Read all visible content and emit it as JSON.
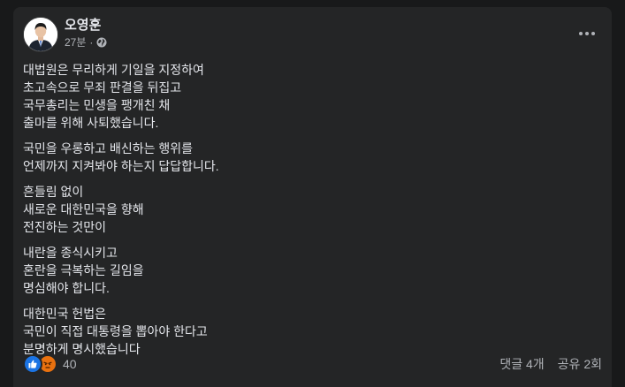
{
  "post": {
    "author": "오영훈",
    "time": "27분",
    "separator": "·",
    "privacy_icon": "globe-icon",
    "more_icon": "more-options-icon",
    "paragraphs": [
      [
        "대법원은 무리하게 기일을 지정하여",
        "초고속으로 무죄 판결을 뒤집고",
        "국무총리는 민생을 팽개친 채",
        "출마를 위해 사퇴했습니다."
      ],
      [
        "국민을 우롱하고 배신하는 행위를",
        "언제까지 지켜봐야 하는지 답답합니다."
      ],
      [
        "흔들림 없이",
        "새로운 대한민국을 향해",
        "전진하는 것만이"
      ],
      [
        "내란을 종식시키고",
        "혼란을 극복하는 길임을",
        "명심해야 합니다."
      ],
      [
        "대한민국 헌법은",
        "국민이 직접 대통령을 뽑아야 한다고",
        "분명하게 명시했습니다"
      ]
    ]
  },
  "footer": {
    "reaction_icons": [
      "like-icon",
      "angry-icon"
    ],
    "reaction_count": "40",
    "comments": "댓글 4개",
    "shares": "공유 2회"
  },
  "colors": {
    "page_bg": "#18191a",
    "card_bg": "#242526",
    "primary_text": "#e4e6eb",
    "secondary_text": "#b0b3b8",
    "like_blue": "#1b74e4",
    "angry_orange": "#e9710f"
  }
}
